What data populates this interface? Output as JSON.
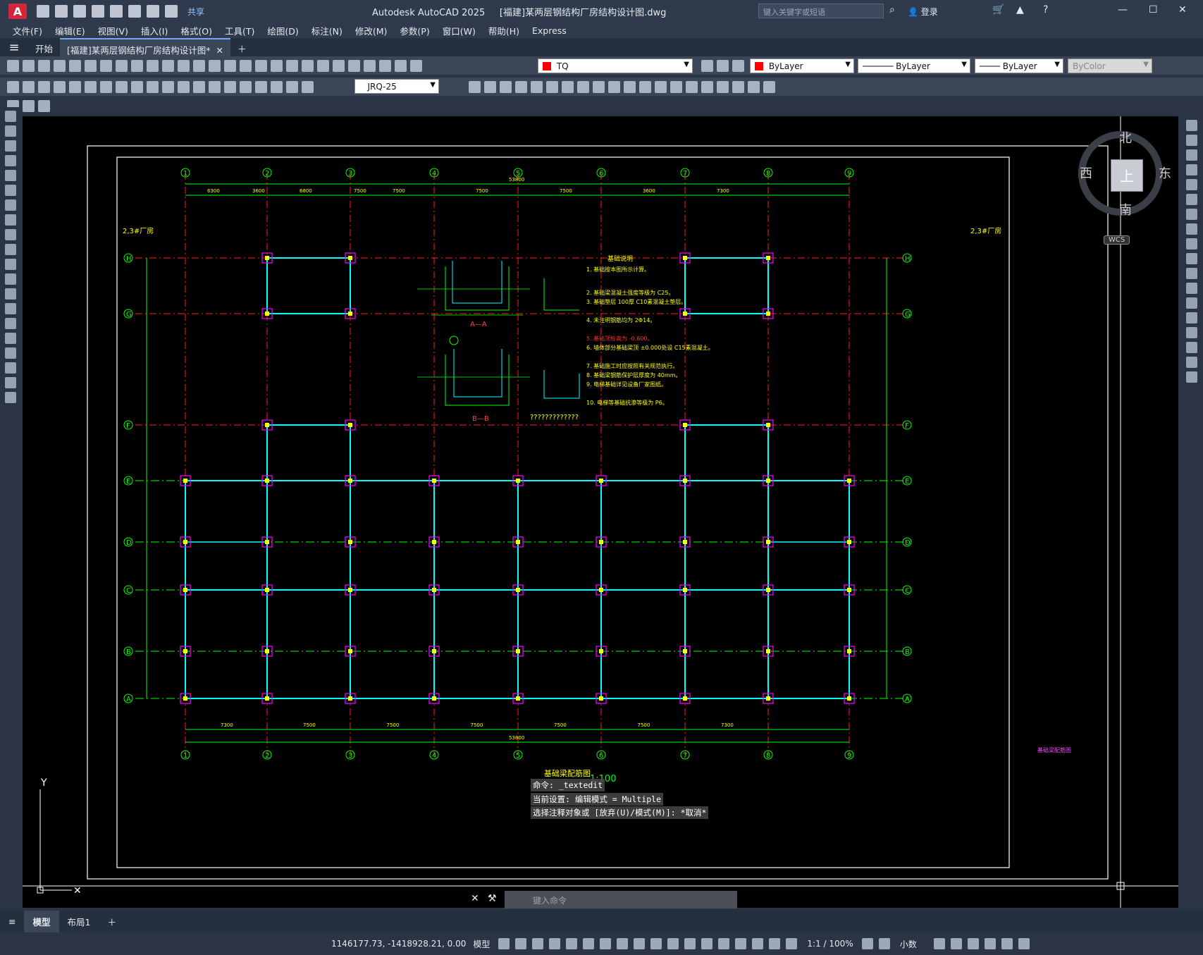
{
  "titlebar": {
    "logo": "A",
    "share": "共享",
    "app_title": "Autodesk AutoCAD 2025",
    "doc_title": "[福建]某两层钢结构厂房结构设计图.dwg",
    "search_placeholder": "键入关键字或短语",
    "login": "登录"
  },
  "menu": [
    "文件(F)",
    "编辑(E)",
    "视图(V)",
    "插入(I)",
    "格式(O)",
    "工具(T)",
    "绘图(D)",
    "标注(N)",
    "修改(M)",
    "参数(P)",
    "窗口(W)",
    "帮助(H)",
    "Express"
  ],
  "tabs": {
    "start": "开始",
    "doc": "[福建]某两层钢结构厂房结构设计图*"
  },
  "properties": {
    "layer": "TQ",
    "color": "ByLayer",
    "linetype": "ByLayer",
    "lineweight": "ByLayer",
    "plotstyle": "ByColor",
    "dimstyle": "JRQ-25",
    "layer_color": "#ff0000"
  },
  "drawing": {
    "grid_numbers": [
      "1",
      "2",
      "3",
      "4",
      "5",
      "6",
      "7",
      "8",
      "9"
    ],
    "grid_letters": [
      "H",
      "G",
      "F",
      "E",
      "D",
      "C",
      "B",
      "A"
    ],
    "section_aa": "A—A",
    "section_bb": "B—B",
    "notes_title": "基础说明",
    "notes": [
      "1. 基础按本图所示计算。",
      "2. 基础梁混凝土强度等级为 C25。",
      "3. 基础垫层 100厚 C10素混凝土垫层。",
      "4. 未注明钢筋均为 2Φ14。",
      "5. 基础顶标高为 -0.600。",
      "6. 墙体部分基础梁顶 ±0.000处设 C15素混凝土。",
      "7. 基础施工时应按照有关规范执行。",
      "8. 基础梁钢筋保护层厚度为 40mm。",
      "9. 电梯基础详见设备厂家图纸。",
      "10. 电梯等基础抗渗等级为 P6。"
    ],
    "unknown_label": "?????????????",
    "wing_label_left": "2,3#厂房",
    "wing_label_right": "2,3#厂房",
    "plan_title": "基础梁配筋图",
    "scale": "1:100",
    "side_label": "基础梁配筋图",
    "top_dims": [
      "6300",
      "3600",
      "6800",
      "7500",
      "7500",
      "7500",
      "7500",
      "3600",
      "7300"
    ],
    "bottom_dims": [
      "7300",
      "7500",
      "7500",
      "7500",
      "7500",
      "7500",
      "7300"
    ],
    "total_dim": "53800"
  },
  "command": {
    "line1": "命令: _textedit",
    "line2": "当前设置: 编辑模式 = Multiple",
    "line3": "选择注释对象或 [放弃(U)/模式(M)]: *取消*",
    "placeholder": "键入命令"
  },
  "viewcube": {
    "north": "北",
    "south": "南",
    "east": "东",
    "west": "西",
    "face": "上",
    "wcs": "WCS"
  },
  "layout_tabs": [
    "模型",
    "布局1"
  ],
  "status": {
    "coords": "1146177.73, -1418928.21, 0.00",
    "model": "模型",
    "scale": "1:1 / 100%",
    "units": "小数"
  },
  "colors": {
    "grid_green": "#00ff00",
    "axis_red": "#ff2020",
    "beam_cyan": "#00ffff",
    "column_magenta": "#ff00ff",
    "text_yellow": "#ffff00",
    "frame_white": "#ffffff"
  }
}
